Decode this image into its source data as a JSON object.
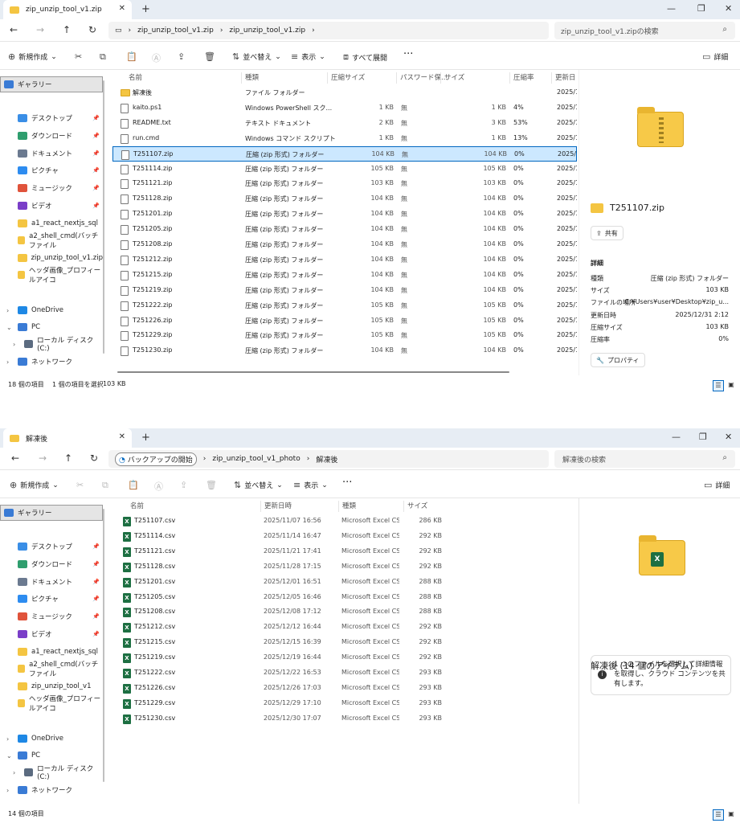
{
  "window1": {
    "tab_title": "zip_unzip_tool_v1.zip",
    "breadcrumb": [
      "zip_unzip_tool_v1.zip",
      "zip_unzip_tool_v1.zip"
    ],
    "search_placeholder": "zip_unzip_tool_v1.zipの検索",
    "toolbar": {
      "new": "新規作成",
      "sort": "並べ替え",
      "view": "表示",
      "extract_all": "すべて展開",
      "details": "詳細"
    },
    "columns": [
      "名前",
      "種類",
      "圧縮サイズ",
      "パスワード保...",
      "サイズ",
      "圧縮率",
      "更新日"
    ],
    "files": [
      {
        "name": "解凍後",
        "type": "ファイル フォルダー",
        "csize": "",
        "pw": "",
        "size": "",
        "ratio": "",
        "date": "2025/1",
        "icon": "folder"
      },
      {
        "name": "kaito.ps1",
        "type": "Windows PowerShell スク...",
        "csize": "1 KB",
        "pw": "無",
        "size": "1 KB",
        "ratio": "4%",
        "date": "2025/1",
        "icon": "file"
      },
      {
        "name": "README.txt",
        "type": "テキスト ドキュメント",
        "csize": "2 KB",
        "pw": "無",
        "size": "3 KB",
        "ratio": "53%",
        "date": "2025/1",
        "icon": "file"
      },
      {
        "name": "run.cmd",
        "type": "Windows コマンド スクリプト",
        "csize": "1 KB",
        "pw": "無",
        "size": "1 KB",
        "ratio": "13%",
        "date": "2025/1",
        "icon": "file"
      },
      {
        "name": "T251107.zip",
        "type": "圧縮 (zip 形式) フォルダー",
        "csize": "104 KB",
        "pw": "無",
        "size": "104 KB",
        "ratio": "0%",
        "date": "2025/1",
        "icon": "file"
      },
      {
        "name": "T251114.zip",
        "type": "圧縮 (zip 形式) フォルダー",
        "csize": "105 KB",
        "pw": "無",
        "size": "105 KB",
        "ratio": "0%",
        "date": "2025/1",
        "icon": "file"
      },
      {
        "name": "T251121.zip",
        "type": "圧縮 (zip 形式) フォルダー",
        "csize": "103 KB",
        "pw": "無",
        "size": "103 KB",
        "ratio": "0%",
        "date": "2025/1",
        "icon": "file"
      },
      {
        "name": "T251128.zip",
        "type": "圧縮 (zip 形式) フォルダー",
        "csize": "104 KB",
        "pw": "無",
        "size": "104 KB",
        "ratio": "0%",
        "date": "2025/1",
        "icon": "file"
      },
      {
        "name": "T251201.zip",
        "type": "圧縮 (zip 形式) フォルダー",
        "csize": "104 KB",
        "pw": "無",
        "size": "104 KB",
        "ratio": "0%",
        "date": "2025/1",
        "icon": "file"
      },
      {
        "name": "T251205.zip",
        "type": "圧縮 (zip 形式) フォルダー",
        "csize": "104 KB",
        "pw": "無",
        "size": "104 KB",
        "ratio": "0%",
        "date": "2025/1",
        "icon": "file"
      },
      {
        "name": "T251208.zip",
        "type": "圧縮 (zip 形式) フォルダー",
        "csize": "104 KB",
        "pw": "無",
        "size": "104 KB",
        "ratio": "0%",
        "date": "2025/1",
        "icon": "file"
      },
      {
        "name": "T251212.zip",
        "type": "圧縮 (zip 形式) フォルダー",
        "csize": "104 KB",
        "pw": "無",
        "size": "104 KB",
        "ratio": "0%",
        "date": "2025/1",
        "icon": "file"
      },
      {
        "name": "T251215.zip",
        "type": "圧縮 (zip 形式) フォルダー",
        "csize": "104 KB",
        "pw": "無",
        "size": "104 KB",
        "ratio": "0%",
        "date": "2025/1",
        "icon": "file"
      },
      {
        "name": "T251219.zip",
        "type": "圧縮 (zip 形式) フォルダー",
        "csize": "104 KB",
        "pw": "無",
        "size": "104 KB",
        "ratio": "0%",
        "date": "2025/1",
        "icon": "file"
      },
      {
        "name": "T251222.zip",
        "type": "圧縮 (zip 形式) フォルダー",
        "csize": "105 KB",
        "pw": "無",
        "size": "105 KB",
        "ratio": "0%",
        "date": "2025/1",
        "icon": "file"
      },
      {
        "name": "T251226.zip",
        "type": "圧縮 (zip 形式) フォルダー",
        "csize": "105 KB",
        "pw": "無",
        "size": "105 KB",
        "ratio": "0%",
        "date": "2025/1",
        "icon": "file"
      },
      {
        "name": "T251229.zip",
        "type": "圧縮 (zip 形式) フォルダー",
        "csize": "105 KB",
        "pw": "無",
        "size": "105 KB",
        "ratio": "0%",
        "date": "2025/1",
        "icon": "file"
      },
      {
        "name": "T251230.zip",
        "type": "圧縮 (zip 形式) フォルダー",
        "csize": "104 KB",
        "pw": "無",
        "size": "104 KB",
        "ratio": "0%",
        "date": "2025/1",
        "icon": "file"
      }
    ],
    "preview": {
      "name": "T251107.zip",
      "share": "共有",
      "details_heading": "詳細",
      "props": [
        {
          "k": "種類",
          "v": "圧縮 (zip 形式) フォルダー"
        },
        {
          "k": "サイズ",
          "v": "103 KB"
        },
        {
          "k": "ファイルの場所",
          "v": "C:¥Users¥user¥Desktop¥zip_u..."
        },
        {
          "k": "更新日時",
          "v": "2025/12/31 2:12"
        },
        {
          "k": "圧縮サイズ",
          "v": "103 KB"
        },
        {
          "k": "圧縮率",
          "v": "0%"
        }
      ],
      "properties_btn": "プロパティ"
    },
    "status": {
      "count": "18 個の項目",
      "selected": "1 個の項目を選択",
      "size": "103 KB"
    }
  },
  "window2": {
    "tab_title": "解凍後",
    "breadcrumb": [
      "バックアップの開始",
      "zip_unzip_tool_v1_photo",
      "解凍後"
    ],
    "search_placeholder": "解凍後の検索",
    "toolbar": {
      "new": "新規作成",
      "sort": "並べ替え",
      "view": "表示",
      "details": "詳細"
    },
    "columns": [
      "名前",
      "更新日時",
      "種類",
      "サイズ"
    ],
    "files": [
      {
        "name": "T251107.csv",
        "date": "2025/11/07 16:56",
        "type": "Microsoft Excel CS...",
        "size": "286 KB"
      },
      {
        "name": "T251114.csv",
        "date": "2025/11/14 16:47",
        "type": "Microsoft Excel CS...",
        "size": "292 KB"
      },
      {
        "name": "T251121.csv",
        "date": "2025/11/21 17:41",
        "type": "Microsoft Excel CS...",
        "size": "292 KB"
      },
      {
        "name": "T251128.csv",
        "date": "2025/11/28 17:15",
        "type": "Microsoft Excel CS...",
        "size": "292 KB"
      },
      {
        "name": "T251201.csv",
        "date": "2025/12/01 16:51",
        "type": "Microsoft Excel CS...",
        "size": "288 KB"
      },
      {
        "name": "T251205.csv",
        "date": "2025/12/05 16:46",
        "type": "Microsoft Excel CS...",
        "size": "288 KB"
      },
      {
        "name": "T251208.csv",
        "date": "2025/12/08 17:12",
        "type": "Microsoft Excel CS...",
        "size": "288 KB"
      },
      {
        "name": "T251212.csv",
        "date": "2025/12/12 16:44",
        "type": "Microsoft Excel CS...",
        "size": "292 KB"
      },
      {
        "name": "T251215.csv",
        "date": "2025/12/15 16:39",
        "type": "Microsoft Excel CS...",
        "size": "292 KB"
      },
      {
        "name": "T251219.csv",
        "date": "2025/12/19 16:44",
        "type": "Microsoft Excel CS...",
        "size": "292 KB"
      },
      {
        "name": "T251222.csv",
        "date": "2025/12/22 16:53",
        "type": "Microsoft Excel CS...",
        "size": "293 KB"
      },
      {
        "name": "T251226.csv",
        "date": "2025/12/26 17:03",
        "type": "Microsoft Excel CS...",
        "size": "293 KB"
      },
      {
        "name": "T251229.csv",
        "date": "2025/12/29 17:10",
        "type": "Microsoft Excel CS...",
        "size": "293 KB"
      },
      {
        "name": "T251230.csv",
        "date": "2025/12/30 17:07",
        "type": "Microsoft Excel CS...",
        "size": "293 KB"
      }
    ],
    "preview": {
      "heading": "解凍後 (14 個のアイテム)",
      "info": "1 つのファイルを選択して詳細情報を取得し、クラウド コンテンツを共有します。"
    },
    "status": {
      "count": "14 個の項目"
    }
  },
  "sidebar": [
    {
      "label": "ギャラリー",
      "color": "#3a7bd5",
      "pin": false,
      "sel": true
    },
    {
      "label": "デスクトップ",
      "color": "#3a8ee6",
      "pin": true
    },
    {
      "label": "ダウンロード",
      "color": "#2f9e6e",
      "pin": true
    },
    {
      "label": "ドキュメント",
      "color": "#6b7a90",
      "pin": true
    },
    {
      "label": "ピクチャ",
      "color": "#2d8cf0",
      "pin": true
    },
    {
      "label": "ミュージック",
      "color": "#e0533b",
      "pin": true
    },
    {
      "label": "ビデオ",
      "color": "#7a3ec8",
      "pin": true
    },
    {
      "label": "a1_react_nextjs_sql",
      "color": "#f4c542",
      "pin": false
    },
    {
      "label": "a2_shell_cmd(バッチファイル",
      "color": "#f4c542",
      "pin": false
    },
    {
      "label": "zip_unzip_tool_v1.zip",
      "color": "#f4c542",
      "pin": false
    },
    {
      "label": "ヘッダ画像_プロフィールアイコ",
      "color": "#f4c542",
      "pin": false
    },
    {
      "label": "OneDrive",
      "color": "#1e88e5",
      "pin": false,
      "tree": true
    },
    {
      "label": "PC",
      "color": "#3a7bd5",
      "pin": false,
      "tree": true,
      "open": true
    },
    {
      "label": "ローカル ディスク (C:)",
      "color": "#5b6b80",
      "pin": false,
      "tree": true,
      "indent": true
    },
    {
      "label": "ネットワーク",
      "color": "#3a7bd5",
      "pin": false,
      "tree": true
    }
  ],
  "sidebar2_labels": [
    "ギャラリー",
    "デスクトップ",
    "ダウンロード",
    "ドキュメント",
    "ピクチャ",
    "ミュージック",
    "ビデオ",
    "a1_react_nextjs_sql",
    "a2_shell_cmd(バッチファイル",
    "zip_unzip_tool_v1",
    "ヘッダ画像_プロフィールアイコ",
    "OneDrive",
    "PC",
    "ローカル ディスク (C:)",
    "ネットワーク"
  ]
}
